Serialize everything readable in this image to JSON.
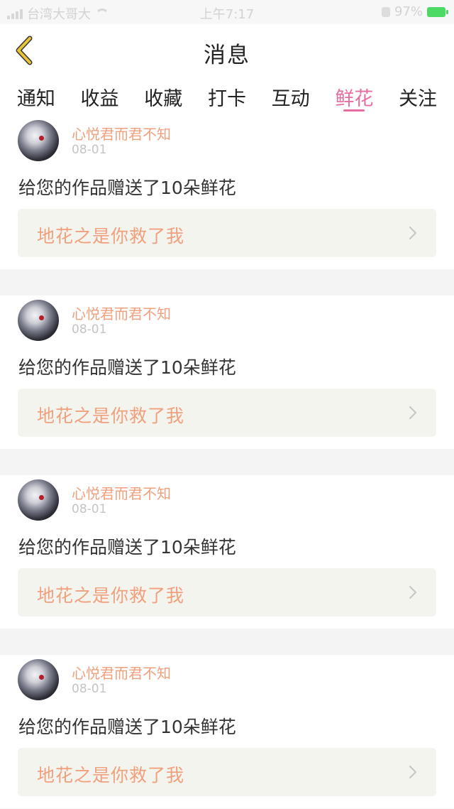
{
  "status_bar": {
    "carrier": "台湾大哥大",
    "time": "上午7:17",
    "battery": "97%",
    "icons": [
      "signal-icon",
      "wifi-icon",
      "lock-rotation-icon",
      "battery-charging-icon"
    ]
  },
  "header": {
    "title": "消息",
    "back_icon": "chevron-left-icon",
    "accent_color": "#e8c437"
  },
  "tabs": [
    {
      "label": "通知",
      "active": false
    },
    {
      "label": "收益",
      "active": false
    },
    {
      "label": "收藏",
      "active": false
    },
    {
      "label": "打卡",
      "active": false
    },
    {
      "label": "互动",
      "active": false
    },
    {
      "label": "鲜花",
      "active": true
    },
    {
      "label": "关注",
      "active": false
    }
  ],
  "active_tab_color": "#e86ca2",
  "notifications": [
    {
      "username": "心悦君而君不知",
      "date": "08-01",
      "message": "给您的作品赠送了10朵鲜花",
      "work_title": "地花之是你救了我"
    },
    {
      "username": "心悦君而君不知",
      "date": "08-01",
      "message": "给您的作品赠送了10朵鲜花",
      "work_title": "地花之是你救了我"
    },
    {
      "username": "心悦君而君不知",
      "date": "08-01",
      "message": "给您的作品赠送了10朵鲜花",
      "work_title": "地花之是你救了我"
    },
    {
      "username": "心悦君而君不知",
      "date": "08-01",
      "message": "给您的作品赠送了10朵鲜花",
      "work_title": "地花之是你救了我"
    }
  ]
}
